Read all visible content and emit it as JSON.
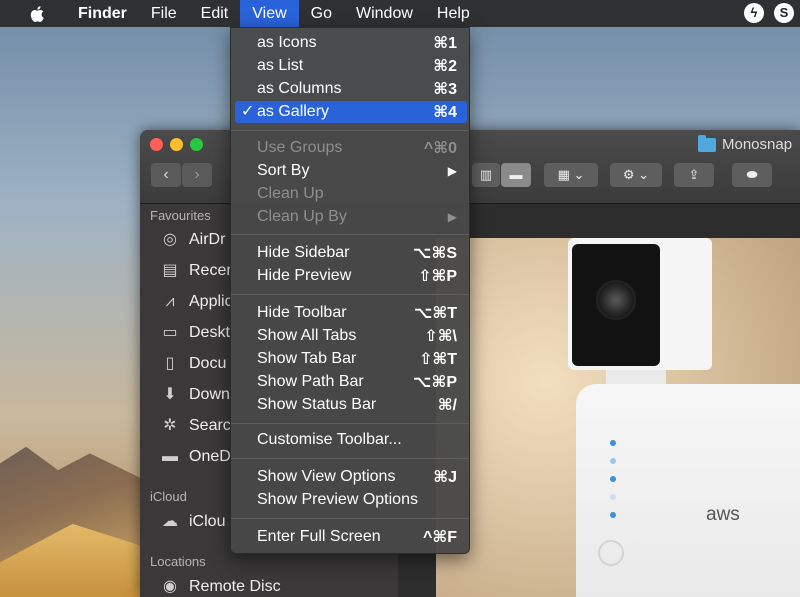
{
  "menubar": {
    "items": [
      "Finder",
      "File",
      "Edit",
      "View",
      "Go",
      "Window",
      "Help"
    ],
    "active": "View"
  },
  "window": {
    "title": "Monosnap"
  },
  "sidebar": {
    "sections": {
      "favourites": "Favourites",
      "icloud": "iCloud",
      "locations": "Locations"
    },
    "items": [
      {
        "label": "AirDr",
        "icon": "airdrop-icon"
      },
      {
        "label": "Recer",
        "icon": "recents-icon"
      },
      {
        "label": "Applic",
        "icon": "applications-icon"
      },
      {
        "label": "Deskt",
        "icon": "desktop-icon"
      },
      {
        "label": "Docu",
        "icon": "documents-icon"
      },
      {
        "label": "Down",
        "icon": "downloads-icon"
      },
      {
        "label": "Searc",
        "icon": "search-icon"
      },
      {
        "label": "OneD",
        "icon": "folder-icon"
      },
      {
        "label": "iClou",
        "icon": "cloud-icon"
      },
      {
        "label": "Remote Disc",
        "icon": "disc-icon"
      }
    ]
  },
  "preview": {
    "brand": "aws"
  },
  "view_menu": {
    "items": [
      {
        "label": "as Icons",
        "shortcut": "⌘1"
      },
      {
        "label": "as List",
        "shortcut": "⌘2"
      },
      {
        "label": "as Columns",
        "shortcut": "⌘3"
      },
      {
        "label": "as Gallery",
        "shortcut": "⌘4",
        "checked": true,
        "highlighted": true
      },
      {
        "label": "Use Groups",
        "shortcut": "^⌘0",
        "disabled": true
      },
      {
        "label": "Sort By",
        "shortcut": "▶"
      },
      {
        "label": "Clean Up",
        "shortcut": "",
        "disabled": true
      },
      {
        "label": "Clean Up By",
        "shortcut": "▶",
        "disabled": true
      },
      {
        "label": "Hide Sidebar",
        "shortcut": "⌥⌘S"
      },
      {
        "label": "Hide Preview",
        "shortcut": "⇧⌘P"
      },
      {
        "label": "Hide Toolbar",
        "shortcut": "⌥⌘T"
      },
      {
        "label": "Show All Tabs",
        "shortcut": "⇧⌘\\"
      },
      {
        "label": "Show Tab Bar",
        "shortcut": "⇧⌘T"
      },
      {
        "label": "Show Path Bar",
        "shortcut": "⌥⌘P"
      },
      {
        "label": "Show Status Bar",
        "shortcut": "⌘/"
      },
      {
        "label": "Customise Toolbar...",
        "shortcut": ""
      },
      {
        "label": "Show View Options",
        "shortcut": "⌘J"
      },
      {
        "label": "Show Preview Options",
        "shortcut": ""
      },
      {
        "label": "Enter Full Screen",
        "shortcut": "^⌘F"
      }
    ]
  },
  "colors": {
    "highlight": "#2a62d9",
    "menu_bg": "#484848"
  }
}
